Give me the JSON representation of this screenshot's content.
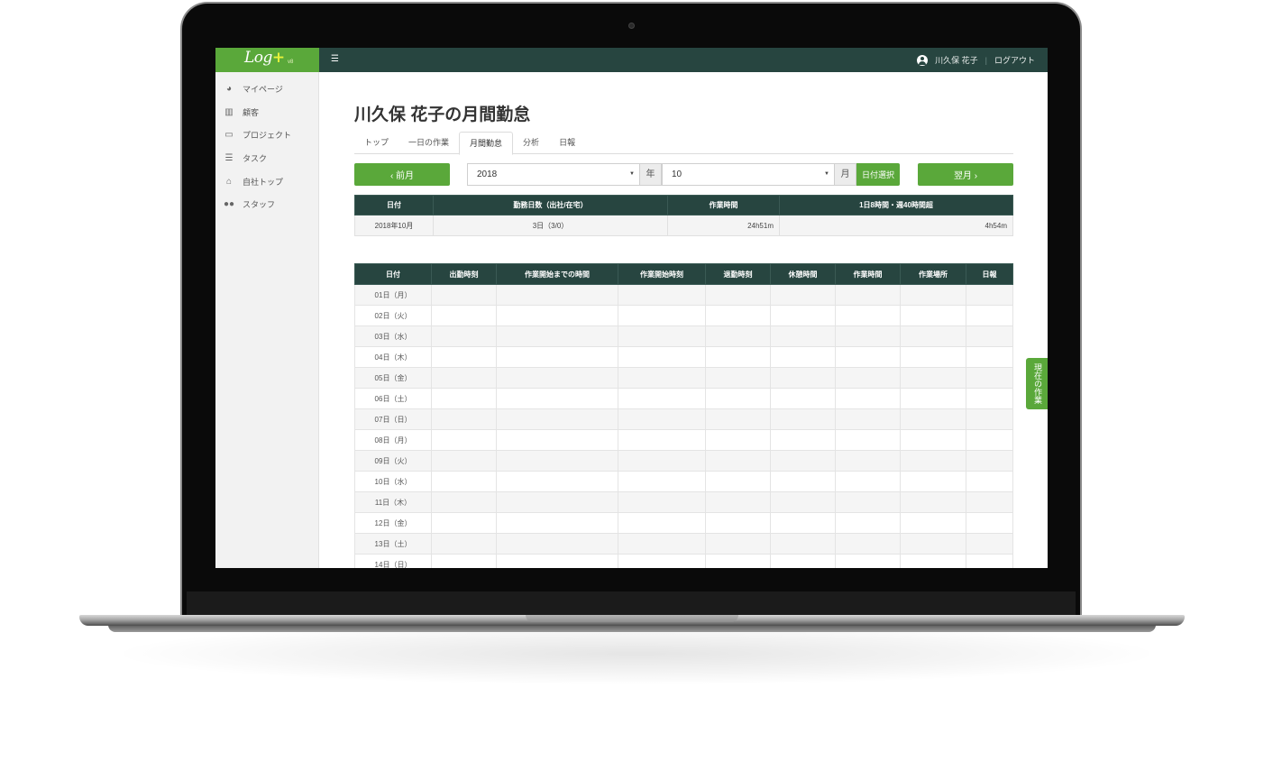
{
  "app": {
    "logo": "Log",
    "logo_plus": "+",
    "version": "v8"
  },
  "topbar": {
    "user_name": "川久保 花子",
    "separator": "|",
    "logout": "ログアウト"
  },
  "sidebar": {
    "items": [
      {
        "label": "マイページ",
        "icon": "dashboard-icon"
      },
      {
        "label": "顧客",
        "icon": "building-icon"
      },
      {
        "label": "プロジェクト",
        "icon": "folder-icon"
      },
      {
        "label": "タスク",
        "icon": "list-icon"
      },
      {
        "label": "自社トップ",
        "icon": "home-icon"
      },
      {
        "label": "スタッフ",
        "icon": "users-icon"
      }
    ]
  },
  "page": {
    "title": "川久保 花子の月間勤怠"
  },
  "tabs": [
    {
      "label": "トップ",
      "active": false
    },
    {
      "label": "一日の作業",
      "active": false
    },
    {
      "label": "月間勤怠",
      "active": true
    },
    {
      "label": "分析",
      "active": false
    },
    {
      "label": "日報",
      "active": false
    }
  ],
  "controls": {
    "prev_label": "‹ 前月",
    "next_label": "翌月 ›",
    "year_value": "2018",
    "year_unit": "年",
    "month_value": "10",
    "month_unit": "月",
    "date_select_label": "日付選択"
  },
  "summary": {
    "headers": [
      "日付",
      "勤務日数（出社/在宅）",
      "作業時間",
      "1日8時間・週40時間超"
    ],
    "row": [
      "2018年10月",
      "3日（3/0）",
      "24h51m",
      "4h54m"
    ]
  },
  "monthly": {
    "headers": [
      "日付",
      "出勤時刻",
      "作業開始までの時間",
      "作業開始時刻",
      "退勤時刻",
      "休憩時間",
      "作業時間",
      "作業場所",
      "日報"
    ],
    "days": [
      "01日（月）",
      "02日（火）",
      "03日（水）",
      "04日（木）",
      "05日（金）",
      "06日（土）",
      "07日（日）",
      "08日（月）",
      "09日（火）",
      "10日（水）",
      "11日（木）",
      "12日（金）",
      "13日（土）",
      "14日（日）"
    ]
  },
  "side_tab": {
    "label": "現在の作業"
  },
  "colors": {
    "topbar": "#274540",
    "accent_green": "#5aa83a",
    "header_dark": "#274540"
  }
}
